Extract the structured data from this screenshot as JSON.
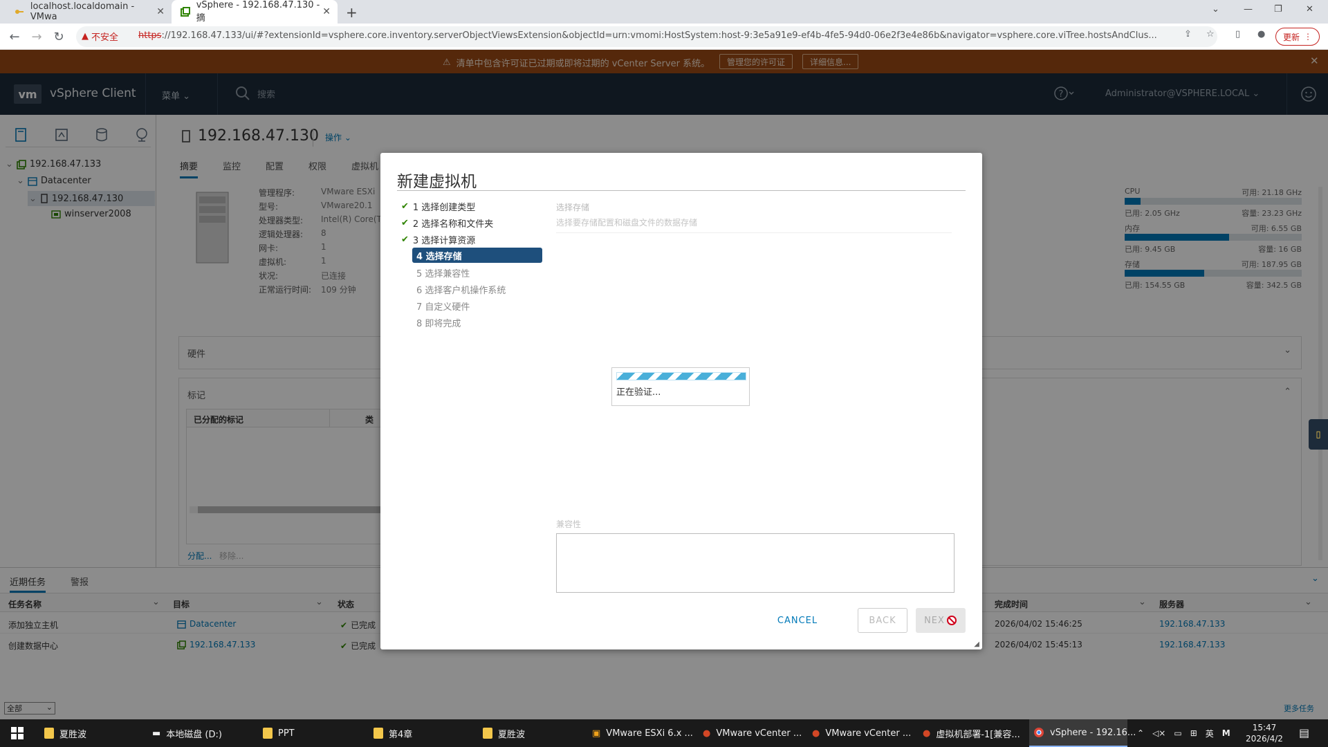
{
  "browser": {
    "tabs": [
      {
        "title": "localhost.localdomain - VMwa"
      },
      {
        "title": "vSphere - 192.168.47.130 - 摘"
      }
    ],
    "new_tab": "+",
    "security_label": "不安全",
    "url_scheme": "https",
    "url_rest": "://192.168.47.133/ui/#?extensionId=vsphere.core.inventory.serverObjectViewsExtension&objectId=urn:vmomi:HostSystem:host-9:3e5a91e9-ef4b-4fe5-94d0-06e2f3e4e86b&navigator=vsphere.core.viTree.hostsAndClus...",
    "update_label": "更新"
  },
  "alert": {
    "message": "清单中包含许可证已过期或即将过期的 vCenter Server 系统。",
    "btn_license": "管理您的许可证",
    "btn_details": "详细信息..."
  },
  "header": {
    "logo": "vm",
    "app_name": "vSphere Client",
    "menu": "菜单",
    "search_placeholder": "搜索",
    "user": "Administrator@VSPHERE.LOCAL"
  },
  "tree": [
    {
      "label": "192.168.47.133"
    },
    {
      "label": "Datacenter"
    },
    {
      "label": "192.168.47.130"
    },
    {
      "label": "winserver2008"
    }
  ],
  "object": {
    "title": "192.168.47.130",
    "actions": "操作",
    "tabs": [
      "摘要",
      "监控",
      "配置",
      "权限",
      "虚拟机"
    ]
  },
  "summary": {
    "keys": [
      "管理程序:",
      "型号:",
      "处理器类型:",
      "逻辑处理器:",
      "网卡:",
      "虚拟机:",
      "状况:",
      "正常运行时间:"
    ],
    "values": [
      "VMware ESXi",
      "VMware20.1",
      "Intel(R) Core(T",
      "8",
      "1",
      "1",
      "已连接",
      "109 分钟"
    ]
  },
  "resources": [
    {
      "name": "CPU",
      "free": "可用: 21.18 GHz",
      "used": "已用: 2.05 GHz",
      "capacity": "容量: 23.23 GHz",
      "fill": 0.088
    },
    {
      "name": "内存",
      "free": "可用: 6.55 GB",
      "used": "已用: 9.45 GB",
      "capacity": "容量: 16 GB",
      "fill": 0.59
    },
    {
      "name": "存储",
      "free": "可用: 187.95 GB",
      "used": "已用: 154.55 GB",
      "capacity": "容量: 342.5 GB",
      "fill": 0.45
    }
  ],
  "sections": {
    "hardware": "硬件",
    "tags": "标记",
    "tags_col": "已分配的标记",
    "tags_col2": "类",
    "assign": "分配...",
    "remove": "移除..."
  },
  "wizard": {
    "title": "新建虚拟机",
    "steps": [
      {
        "label": "1 选择创建类型",
        "state": "done"
      },
      {
        "label": "2 选择名称和文件夹",
        "state": "done"
      },
      {
        "label": "3 选择计算资源",
        "state": "done"
      },
      {
        "label": "4 选择存储",
        "state": "current"
      },
      {
        "label": "5 选择兼容性",
        "state": "todo"
      },
      {
        "label": "6 选择客户机操作系统",
        "state": "todo"
      },
      {
        "label": "7 自定义硬件",
        "state": "todo"
      },
      {
        "label": "8 即将完成",
        "state": "todo"
      }
    ],
    "panel_title": "选择存储",
    "panel_subtitle": "选择要存储配置和磁盘文件的数据存储",
    "loading_text": "正在验证...",
    "compat_label": "兼容性",
    "cancel": "CANCEL",
    "back": "BACK",
    "next": "NEX"
  },
  "tasks": {
    "tabs": [
      "近期任务",
      "警报"
    ],
    "columns": [
      "任务名称",
      "目标",
      "状态",
      "完成时间",
      "服务器"
    ],
    "rows": [
      {
        "name": "添加独立主机",
        "target": "Datacenter",
        "status": "已完成",
        "time": "2026/04/02 15:46:25",
        "server": "192.168.47.133"
      },
      {
        "name": "创建数据中心",
        "target": "192.168.47.133",
        "status": "已完成",
        "time": "2026/04/02 15:45:13",
        "server": "192.168.47.133"
      }
    ],
    "filter": "全部",
    "more": "更多任务"
  },
  "taskbar": {
    "items": [
      "夏胜波",
      "本地磁盘 (D:)",
      "PPT",
      "第4章",
      "夏胜波",
      "VMware ESXi 6.x ...",
      "VMware vCenter ...",
      "VMware vCenter ...",
      "虚拟机部署-1[兼容...",
      "vSphere - 192.16..."
    ],
    "ime": "英",
    "ime2": "M",
    "time": "15:47",
    "date": "2026/4/2"
  }
}
